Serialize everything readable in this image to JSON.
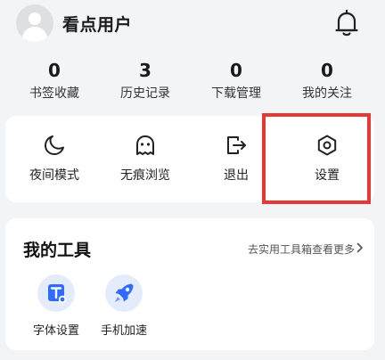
{
  "header": {
    "username": "看点用户",
    "avatar_icon": "user-avatar-icon",
    "notification_icon": "bell-icon"
  },
  "stats": [
    {
      "value": "0",
      "label": "书签收藏"
    },
    {
      "value": "3",
      "label": "历史记录"
    },
    {
      "value": "0",
      "label": "下载管理"
    },
    {
      "value": "0",
      "label": "我的关注"
    }
  ],
  "actions": [
    {
      "label": "夜间模式",
      "icon": "moon-icon"
    },
    {
      "label": "无痕浏览",
      "icon": "ghost-icon"
    },
    {
      "label": "退出",
      "icon": "exit-icon"
    },
    {
      "label": "设置",
      "icon": "hexagon-settings-icon"
    }
  ],
  "tools": {
    "title": "我的工具",
    "more_link": "去实用工具箱查看更多",
    "items": [
      {
        "label": "字体设置",
        "icon": "font-settings-icon"
      },
      {
        "label": "手机加速",
        "icon": "rocket-icon"
      }
    ]
  },
  "colors": {
    "highlight": "#e53935",
    "tool_accent": "#2f6bff",
    "page_background": "#f3f4f6"
  }
}
